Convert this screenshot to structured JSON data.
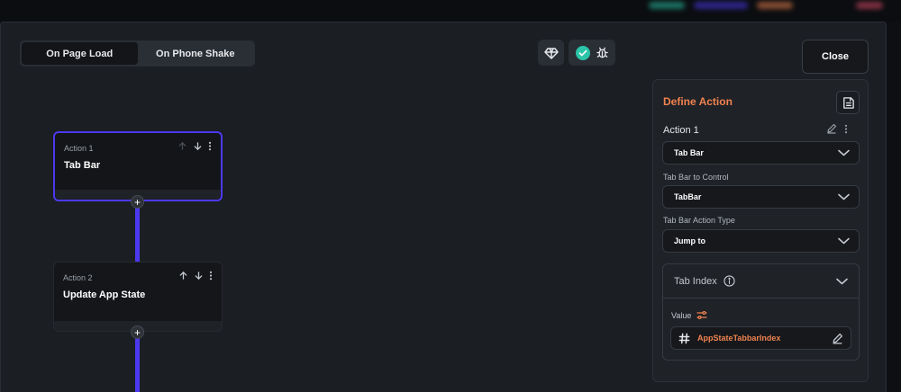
{
  "trigger_tabs": [
    {
      "label": "On Page Load",
      "active": true
    },
    {
      "label": "On Phone Shake",
      "active": false
    }
  ],
  "toolbar": {
    "close_label": "Close"
  },
  "flow": {
    "actions": [
      {
        "index_label": "Action 1",
        "title": "Tab Bar",
        "selected": true
      },
      {
        "index_label": "Action 2",
        "title": "Update App State",
        "selected": false
      }
    ]
  },
  "define_action": {
    "title": "Define Action",
    "action_name": "Action 1",
    "action_type": "Tab Bar",
    "tab_bar_to_control_label": "Tab Bar to Control",
    "tab_bar_to_control_value": "TabBar",
    "action_type_label": "Tab Bar Action Type",
    "action_type_value": "Jump to",
    "tab_index_label": "Tab Index",
    "value_label": "Value",
    "value": "AppStateTabbarIndex"
  },
  "colors": {
    "accent": "#4b39ef",
    "highlight": "#f0834f",
    "success": "#2bc4a9"
  }
}
